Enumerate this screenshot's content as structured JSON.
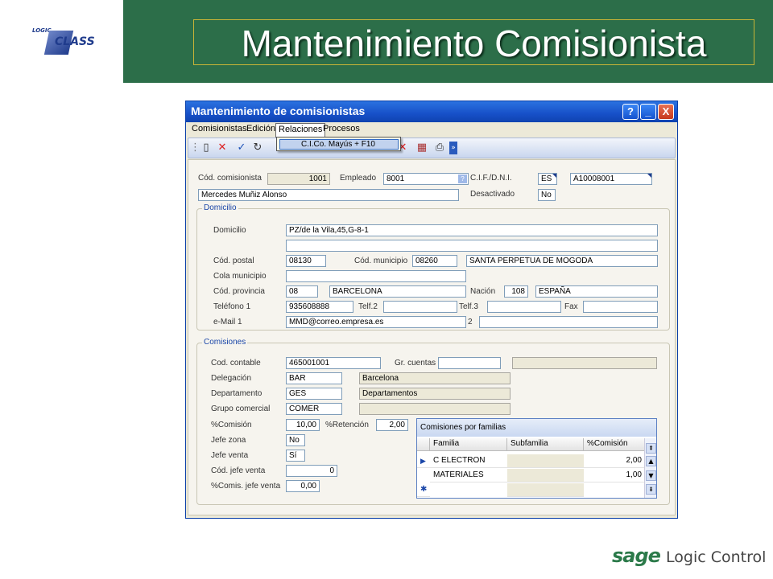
{
  "slide": {
    "logo_small": "LOGIC",
    "logo_big": "CLASS",
    "title": "Mantenimiento Comisionista",
    "footer_brand": "sage",
    "footer_name": "Logic Control"
  },
  "window": {
    "title": "Mantenimiento de comisionistas",
    "help_label": "?",
    "minimize_label": "_",
    "close_label": "X"
  },
  "menu": {
    "comisionistas": "Comisionistas",
    "edicion": "Edición",
    "relaciones": "Relaciones",
    "procesos": "Procesos",
    "dropdown_item": "C.I.Co. Mayús + F10"
  },
  "form": {
    "cod_comisionista_label": "Cód. comisionista",
    "cod_comisionista": "1001",
    "empleado_label": "Empleado",
    "empleado": "8001",
    "cif_label": "C.I.F./D.N.I.",
    "cif_country": "ES",
    "cif_number": "A10008001",
    "nombre": "Mercedes Muñiz Alonso",
    "desactivado_label": "Desactivado",
    "desactivado": "No"
  },
  "domicilio": {
    "section_title": "Domicilio",
    "domicilio_label": "Domicilio",
    "domicilio": "PZ/de la Vila,45,G-8-1",
    "domicilio2": "",
    "cod_postal_label": "Cód. postal",
    "cod_postal": "08130",
    "cod_municipio_label": "Cód. municipio",
    "cod_municipio": "08260",
    "municipio": "SANTA PERPETUA DE MOGODA",
    "cola_municipio_label": "Cola municipio",
    "cola_municipio": "",
    "cod_provincia_label": "Cód. provincia",
    "cod_provincia": "08",
    "provincia": "BARCELONA",
    "nacion_label": "Nación",
    "nacion_code": "108",
    "nacion": "ESPAÑA",
    "telefono1_label": "Teléfono 1",
    "telefono1": "935608888",
    "telf2_label": "Telf.2",
    "telf2": "",
    "telf3_label": "Telf.3",
    "telf3": "",
    "fax_label": "Fax",
    "fax": "",
    "email1_label": "e-Mail 1",
    "email1": "MMD@correo.empresa.es",
    "email2_label": "2",
    "email2": ""
  },
  "comisiones": {
    "section_title": "Comisiones",
    "cod_contable_label": "Cod. contable",
    "cod_contable": "465001001",
    "gr_cuentas_label": "Gr. cuentas",
    "gr_cuentas": "",
    "gr_cuentas_desc": "",
    "delegacion_label": "Delegación",
    "delegacion": "BAR",
    "delegacion_desc": "Barcelona",
    "departamento_label": "Departamento",
    "departamento": "GES",
    "departamento_desc": "Departamentos",
    "grupo_comercial_label": "Grupo comercial",
    "grupo_comercial": "COMER",
    "grupo_comercial_desc": "",
    "comision_label": "%Comisión",
    "comision": "10,00",
    "retencion_label": "%Retención",
    "retencion": "2,00",
    "jefe_zona_label": "Jefe zona",
    "jefe_zona": "No",
    "jefe_venta_label": "Jefe venta",
    "jefe_venta": "Sí",
    "cod_jefe_venta_label": "Cód. jefe venta",
    "cod_jefe_venta": "0",
    "comis_jefe_venta_label": "%Comis. jefe venta",
    "comis_jefe_venta": "0,00"
  },
  "grid": {
    "title": "Comisiones por familias",
    "columns": [
      "Familia",
      "Subfamilia",
      "%Comisión"
    ],
    "rows": [
      {
        "familia": "C ELECTRON",
        "subfamilia": "",
        "comision": "2,00"
      },
      {
        "familia": "MATERIALES",
        "subfamilia": "",
        "comision": "1,00"
      }
    ],
    "new_row_marker": "✱",
    "current_row_marker": "▶"
  },
  "icons": [
    "new-icon",
    "delete-icon",
    "accept-icon",
    "refresh-icon",
    "calendar-icon",
    "print-icon",
    "toolbar-more-icon"
  ]
}
